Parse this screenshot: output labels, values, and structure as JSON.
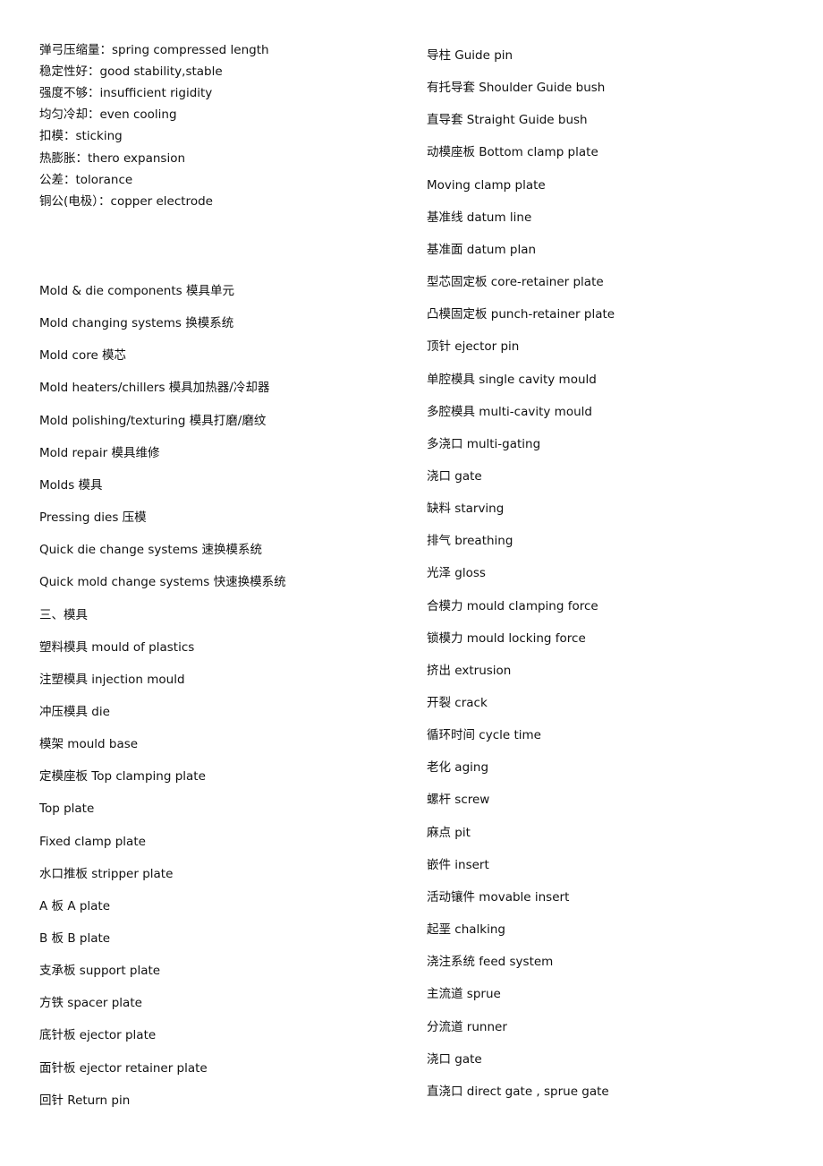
{
  "left_top": [
    "弹弓压缩量：spring compressed length",
    "稳定性好：good stability,stable",
    "强度不够：insufficient rigidity",
    "均匀冷却：even cooling",
    "扣模：sticking",
    "热膨胀：thero expansion",
    "公差：tolorance",
    "铜公(电极）：copper electrode"
  ],
  "left_main": [
    "Mold & die components 模具单元",
    "Mold changing systems 换模系统",
    "Mold core 模芯",
    "Mold heaters/chillers 模具加热器/冷却器",
    "Mold polishing/texturing 模具打磨/磨纹",
    "Mold repair 模具维修",
    "Molds 模具",
    "Pressing dies 压模",
    "Quick die change systems 速换模系统",
    "Quick mold change systems 快速换模系统",
    "三、模具",
    "塑料模具 mould of plastics",
    "注塑模具 injection mould",
    "冲压模具 die",
    "模架 mould base",
    "定模座板 Top clamping plate",
    "Top plate",
    "Fixed clamp plate",
    "水口推板 stripper plate",
    "A 板 A plate",
    "B 板 B plate",
    "支承板 support plate",
    "方铁 spacer plate",
    "底针板 ejector plate",
    "面针板 ejector retainer plate",
    "回针 Return pin"
  ],
  "right": [
    "导柱 Guide pin",
    "有托导套 Shoulder Guide bush",
    "直导套 Straight Guide bush",
    "动模座板 Bottom clamp plate",
    "Moving clamp plate",
    "基准线 datum line",
    "基准面 datum plan",
    "型芯固定板 core-retainer plate",
    "凸模固定板 punch-retainer plate",
    "顶针 ejector pin",
    "单腔模具 single cavity mould",
    "多腔模具 multi-cavity mould",
    "多浇口 multi-gating",
    "浇口 gate",
    "缺料 starving",
    "排气 breathing",
    "光泽 gloss",
    "合模力 mould clamping force",
    "锁模力 mould locking force",
    "挤出 extrusion",
    "开裂 crack",
    "循环时间 cycle time",
    "老化 aging",
    "螺杆 screw",
    "麻点 pit",
    "嵌件 insert",
    "活动镶件 movable insert",
    "起垩 chalking",
    "浇注系统 feed system",
    "主流道 sprue",
    "分流道 runner",
    "浇口 gate",
    "直浇口 direct gate , sprue gate"
  ]
}
